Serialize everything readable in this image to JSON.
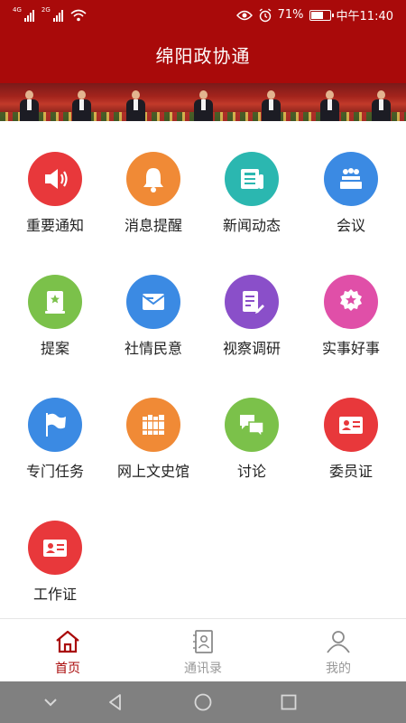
{
  "status_bar": {
    "network1": "4G",
    "network2": "2G",
    "battery_percent": "71%",
    "battery_level": 0.71,
    "time": "中午11:40",
    "icons": [
      "eye-icon",
      "alarm-icon",
      "wifi-icon",
      "battery-icon"
    ]
  },
  "app": {
    "title": "绵阳政协通",
    "accent_color": "#a90a0a"
  },
  "grid_items": [
    {
      "label": "重要通知",
      "icon": "megaphone-icon",
      "color": "#e8383b"
    },
    {
      "label": "消息提醒",
      "icon": "bell-icon",
      "color": "#f08a36"
    },
    {
      "label": "新闻动态",
      "icon": "newspaper-icon",
      "color": "#2bb7b0"
    },
    {
      "label": "会议",
      "icon": "meeting-icon",
      "color": "#3b8ae3"
    },
    {
      "label": "提案",
      "icon": "proposal-icon",
      "color": "#7bc14a"
    },
    {
      "label": "社情民意",
      "icon": "envelope-icon",
      "color": "#3b8ae3"
    },
    {
      "label": "视察调研",
      "icon": "document-edit-icon",
      "color": "#8a4fc9"
    },
    {
      "label": "实事好事",
      "icon": "star-badge-icon",
      "color": "#e04fa8"
    },
    {
      "label": "专门任务",
      "icon": "flag-icon",
      "color": "#3b8ae3"
    },
    {
      "label": "网上文史馆",
      "icon": "books-icon",
      "color": "#f08a36"
    },
    {
      "label": "讨论",
      "icon": "chat-icon",
      "color": "#7bc14a"
    },
    {
      "label": "委员证",
      "icon": "id-card-icon",
      "color": "#e8383b"
    },
    {
      "label": "工作证",
      "icon": "id-card-icon",
      "color": "#e8383b"
    }
  ],
  "tab_bar": [
    {
      "label": "首页",
      "icon": "home-icon",
      "active": true
    },
    {
      "label": "通讯录",
      "icon": "contacts-icon",
      "active": false
    },
    {
      "label": "我的",
      "icon": "profile-icon",
      "active": false
    }
  ],
  "nav_bar": {
    "buttons": [
      "chevron-down-icon",
      "back-icon",
      "home-circle-icon",
      "recents-icon"
    ]
  }
}
